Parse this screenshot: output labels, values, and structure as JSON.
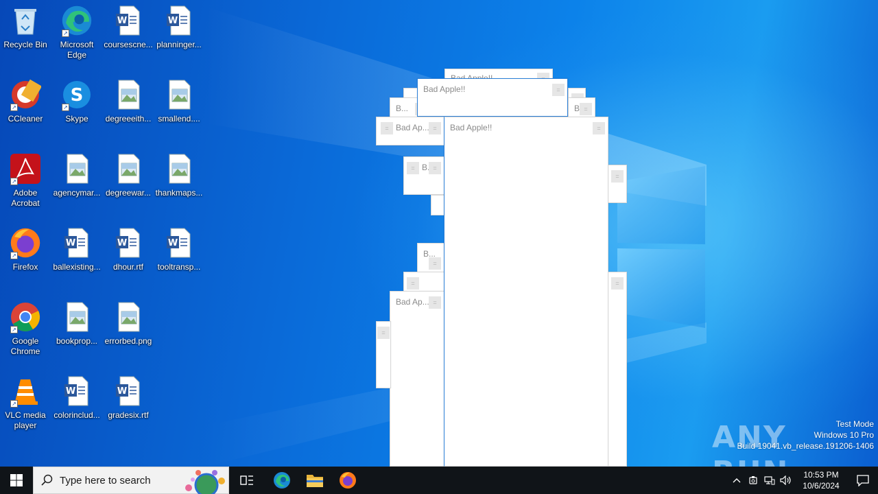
{
  "desktop": {
    "icons": [
      {
        "label": "Recycle Bin",
        "type": "recycle"
      },
      {
        "label": "Microsoft Edge",
        "type": "edge"
      },
      {
        "label": "coursescne...",
        "type": "word"
      },
      {
        "label": "planninger...",
        "type": "word"
      },
      {
        "label": "CCleaner",
        "type": "ccleaner"
      },
      {
        "label": "Skype",
        "type": "skype"
      },
      {
        "label": "degreeeith...",
        "type": "image"
      },
      {
        "label": "smallend....",
        "type": "image"
      },
      {
        "label": "Adobe Acrobat",
        "type": "acrobat"
      },
      {
        "label": "agencymar...",
        "type": "image"
      },
      {
        "label": "degreewar...",
        "type": "image"
      },
      {
        "label": "thankmaps...",
        "type": "image"
      },
      {
        "label": "Firefox",
        "type": "firefox"
      },
      {
        "label": "ballexisting...",
        "type": "word"
      },
      {
        "label": "dhour.rtf",
        "type": "word"
      },
      {
        "label": "tooltransp...",
        "type": "word"
      },
      {
        "label": "Google Chrome",
        "type": "chrome"
      },
      {
        "label": "bookprop...",
        "type": "image"
      },
      {
        "label": "errorbed.png",
        "type": "image"
      },
      {
        "label": "VLC media player",
        "type": "vlc"
      },
      {
        "label": "colorinclud...",
        "type": "word"
      },
      {
        "label": "gradesix.rtf",
        "type": "word"
      }
    ]
  },
  "windows": {
    "main_title": "Bad Apple!!",
    "top_title": "Bad Apple!!",
    "back_title": "Bad Apple!!",
    "short_title": "Bad Ap...",
    "short_title_2": "Bad Ap...",
    "tiny_title": "B...",
    "tiny_title_2": "B...",
    "tiny_title_3": "B...",
    "tiny_title_4": "B...",
    "close_glyph": "="
  },
  "watermark": {
    "logo_text": "ANY RUN",
    "line1": "Test Mode",
    "line2": "Windows 10 Pro",
    "line3": "Build 19041.vb_release.191206-1406"
  },
  "taskbar": {
    "search_placeholder": "Type here to search",
    "clock_time": "10:53 PM",
    "clock_date": "10/6/2024"
  }
}
